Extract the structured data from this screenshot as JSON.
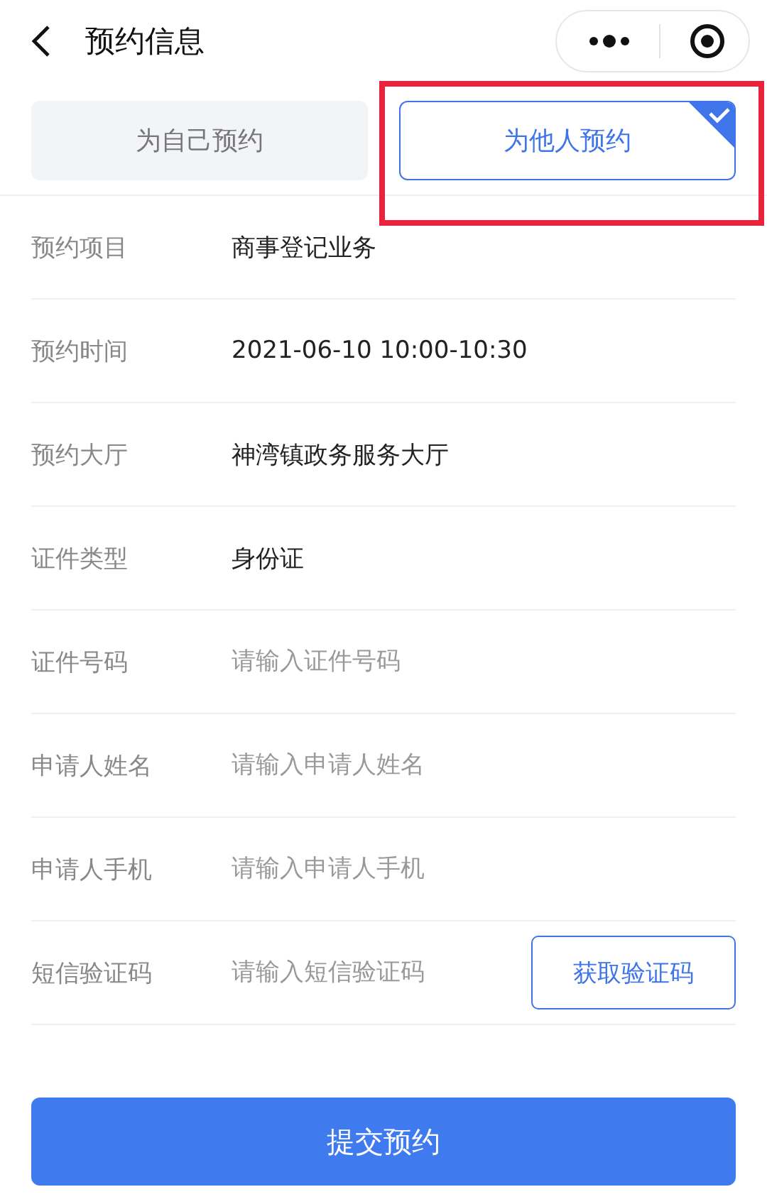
{
  "nav": {
    "title": "预约信息"
  },
  "tabs": [
    {
      "label": "为自己预约",
      "selected": false,
      "highlighted": false
    },
    {
      "label": "为他人预约",
      "selected": true,
      "highlighted": true
    }
  ],
  "rows": [
    {
      "kind": "value",
      "label": "预约项目",
      "value": "商事登记业务"
    },
    {
      "kind": "value",
      "label": "预约时间",
      "value": "2021-06-10 10:00-10:30"
    },
    {
      "kind": "value",
      "label": "预约大厅",
      "value": "神湾镇政务服务大厅"
    },
    {
      "kind": "value",
      "label": "证件类型",
      "value": "身份证"
    },
    {
      "kind": "input",
      "label": "证件号码",
      "placeholder": "请输入证件号码"
    },
    {
      "kind": "input",
      "label": "申请人姓名",
      "placeholder": "请输入申请人姓名"
    },
    {
      "kind": "input",
      "label": "申请人手机",
      "placeholder": "请输入申请人手机"
    },
    {
      "kind": "code",
      "label": "短信验证码",
      "placeholder": "请输入短信验证码",
      "button": "获取验证码"
    }
  ],
  "submit": "提交预约"
}
